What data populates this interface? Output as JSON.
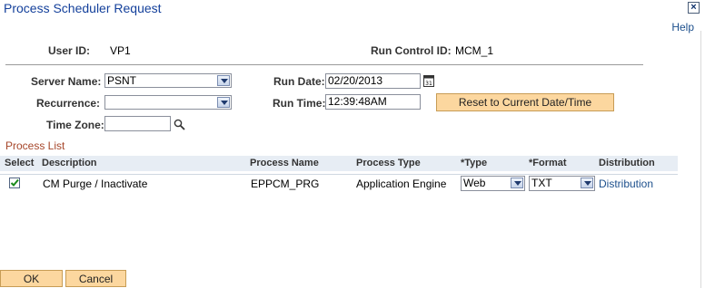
{
  "window": {
    "title": "Process Scheduler Request",
    "close_icon": "close-icon",
    "help": "Help"
  },
  "header": {
    "user_id_label": "User ID:",
    "user_id_value": "VP1",
    "run_control_label": "Run Control ID:",
    "run_control_value": "MCM_1"
  },
  "form": {
    "server_name_label": "Server Name:",
    "server_name_value": "PSNT",
    "run_date_label": "Run Date:",
    "run_date_value": "02/20/2013",
    "recurrence_label": "Recurrence:",
    "recurrence_value": "",
    "run_time_label": "Run Time:",
    "run_time_value": "12:39:48AM",
    "reset_button": "Reset to Current Date/Time",
    "time_zone_label": "Time Zone:",
    "time_zone_value": ""
  },
  "process_list": {
    "title": "Process List",
    "columns": [
      "Select",
      "Description",
      "Process Name",
      "Process Type",
      "*Type",
      "*Format",
      "Distribution"
    ],
    "rows": [
      {
        "selected": true,
        "description": "CM Purge / Inactivate",
        "process_name": "EPPCM_PRG",
        "process_type": "Application Engine",
        "type": "Web",
        "format": "TXT",
        "distribution": "Distribution"
      }
    ]
  },
  "footer": {
    "ok": "OK",
    "cancel": "Cancel"
  },
  "colors": {
    "title_blue": "#14409b",
    "section_red": "#a6462a",
    "button_orange": "#fcd79f",
    "grid_header": "#e7edf4"
  }
}
